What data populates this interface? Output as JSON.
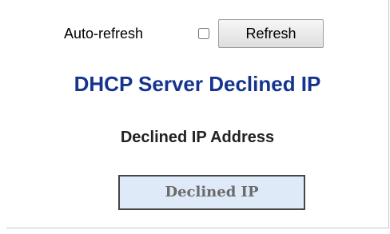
{
  "refresh_bar": {
    "auto_refresh_label": "Auto-refresh",
    "auto_refresh_checked": false,
    "refresh_button_label": "Refresh"
  },
  "page": {
    "title": "DHCP Server Declined IP",
    "section_title": "Declined IP Address"
  },
  "table": {
    "columns": [
      "Declined IP"
    ]
  },
  "colors": {
    "title": "#14348f",
    "table_header_bg": "#deeaf8"
  }
}
